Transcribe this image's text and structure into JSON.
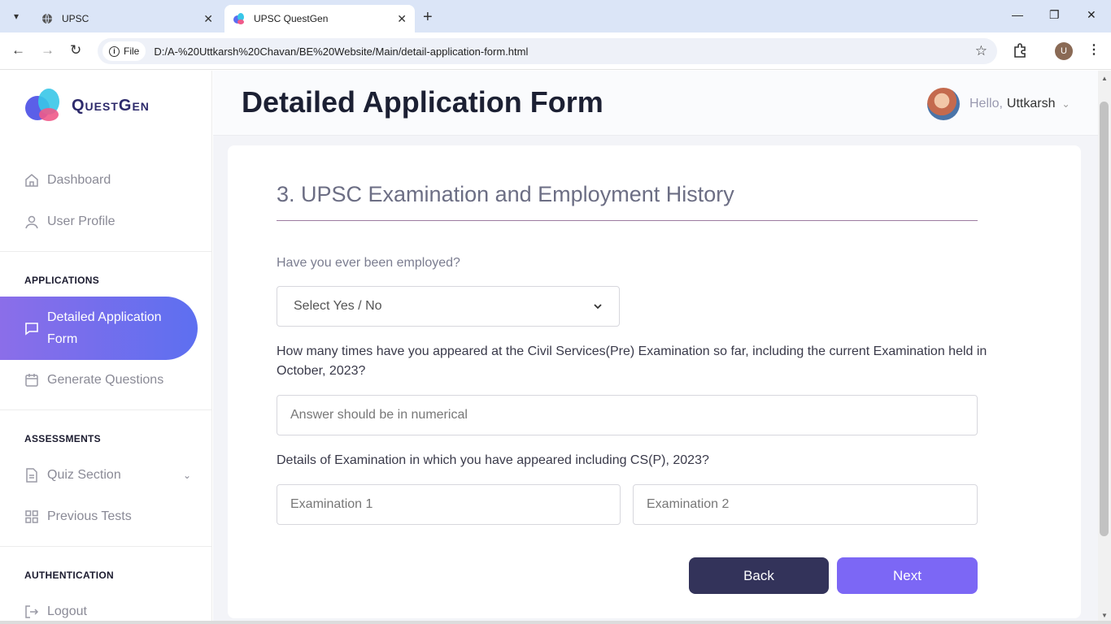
{
  "browser": {
    "tabs": [
      {
        "title": "UPSC",
        "icon": "globe-icon"
      },
      {
        "title": "UPSC QuestGen",
        "icon": "questgen-favicon"
      }
    ],
    "url_chip": "File",
    "url": "D:/A-%20Uttkarsh%20Chavan/BE%20Website/Main/detail-application-form.html",
    "profile_initial": "U"
  },
  "sidebar": {
    "logo_text": "QuestGen",
    "items": [
      {
        "label": "Dashboard",
        "icon": "home-icon"
      },
      {
        "label": "User Profile",
        "icon": "user-icon"
      }
    ],
    "applications_heading": "APPLICATIONS",
    "active_item": "Detailed Application Form",
    "active_line1": "Detailed Application",
    "active_line2": "Form",
    "generate": "Generate Questions",
    "assessments_heading": "ASSESSMENTS",
    "quiz": "Quiz Section",
    "previous": "Previous Tests",
    "auth_heading": "AUTHENTICATION",
    "logout": "Logout"
  },
  "header": {
    "title": "Detailed Application Form",
    "hello": "Hello,",
    "user": "Uttkarsh"
  },
  "form": {
    "section_title": "3. UPSC Examination and Employment History",
    "q_employed": "Have you ever been employed?",
    "select_value": "Select Yes / No",
    "q_attempts": "How many times have you appeared at the Civil Services(Pre) Examination so far, including the current Examination held in October, 2023?",
    "attempts_placeholder": "Answer should be in numerical",
    "q_details": "Details of Examination in which you have appeared including CS(P), 2023?",
    "exam1_placeholder": "Examination 1",
    "exam2_placeholder": "Examination 2",
    "back": "Back",
    "next": "Next"
  },
  "colors": {
    "accent": "#7c67f5",
    "back_button": "#33335a",
    "active_gradient_start": "#8b6ee9",
    "active_gradient_end": "#5d6ff0"
  }
}
